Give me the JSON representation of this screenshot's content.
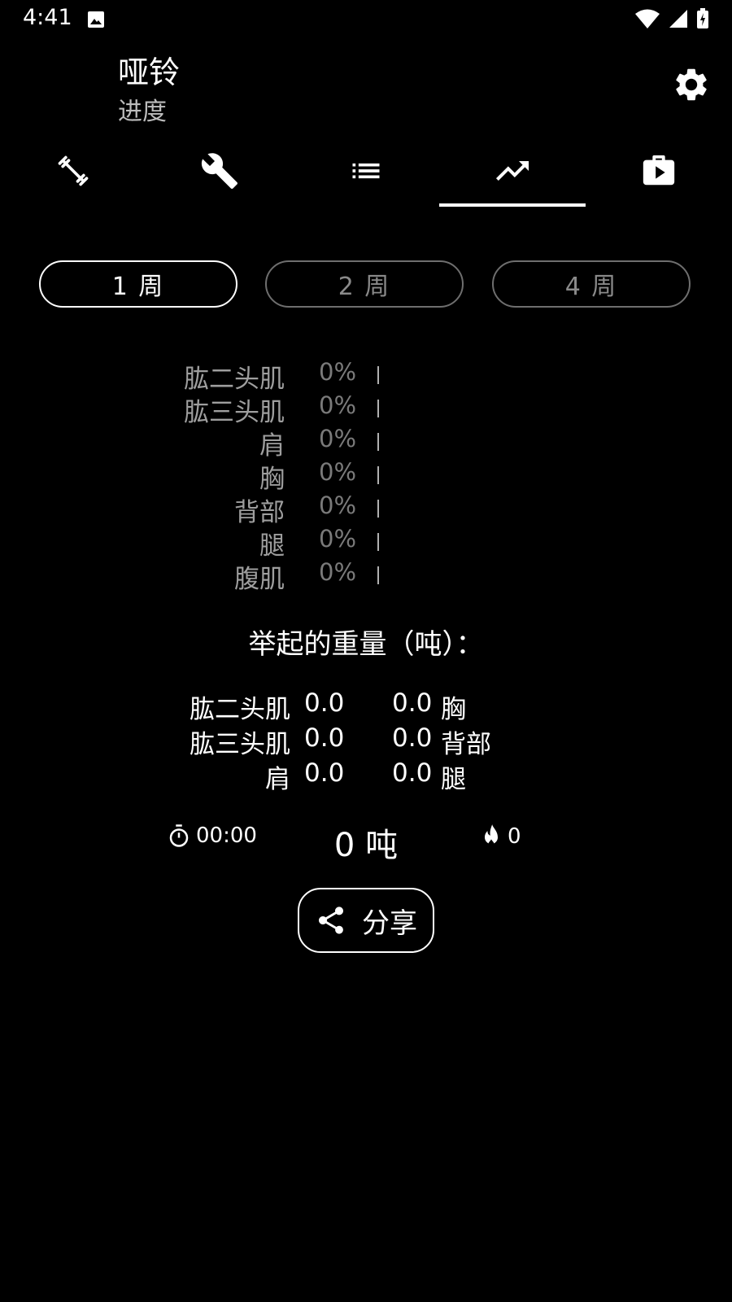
{
  "status_bar": {
    "time": "4:41"
  },
  "header": {
    "title": "哑铃",
    "subtitle": "进度"
  },
  "tabs": [
    {
      "icon": "dumbbell-icon"
    },
    {
      "icon": "wrench-icon"
    },
    {
      "icon": "list-icon"
    },
    {
      "icon": "trending-up-icon",
      "selected": true
    },
    {
      "icon": "video-library-icon"
    }
  ],
  "periods": [
    {
      "label": "1 周",
      "selected": true
    },
    {
      "label": "2 周"
    },
    {
      "label": "4 周"
    }
  ],
  "muscle_progress": [
    {
      "name": "肱二头肌",
      "percent": "0%"
    },
    {
      "name": "肱三头肌",
      "percent": "0%"
    },
    {
      "name": "肩",
      "percent": "0%"
    },
    {
      "name": "胸",
      "percent": "0%"
    },
    {
      "name": "背部",
      "percent": "0%"
    },
    {
      "name": "腿",
      "percent": "0%"
    },
    {
      "name": "腹肌",
      "percent": "0%"
    }
  ],
  "weight": {
    "heading": "举起的重量（吨）：",
    "rows": [
      {
        "left_name": "肱二头肌",
        "left_value": "0.0",
        "right_value": "0.0",
        "right_name": "胸"
      },
      {
        "left_name": "肱三头肌",
        "left_value": "0.0",
        "right_value": "0.0",
        "right_name": "背部"
      },
      {
        "left_name": "肩",
        "left_value": "0.0",
        "right_value": "0.0",
        "right_name": "腿"
      }
    ]
  },
  "summary": {
    "duration": "00:00",
    "total": "0 吨",
    "calories": "0"
  },
  "share": {
    "label": "分享"
  }
}
